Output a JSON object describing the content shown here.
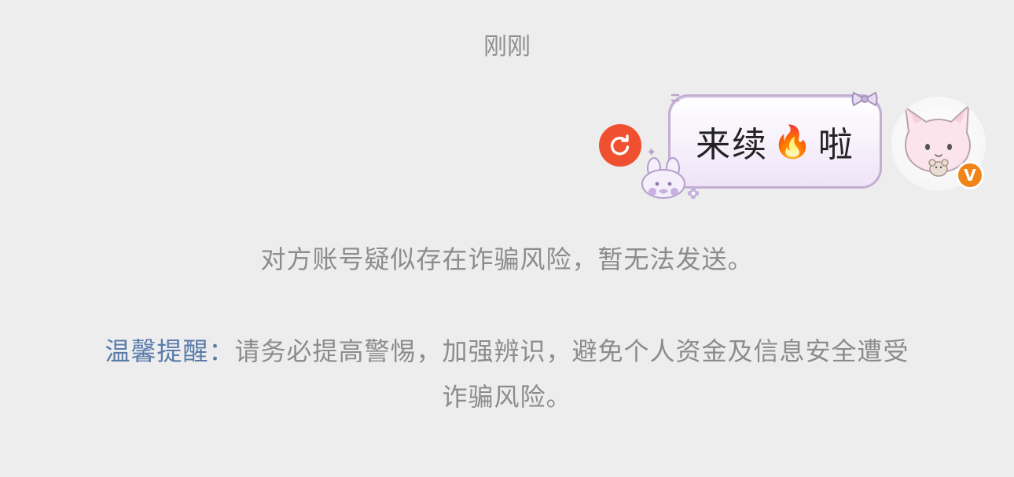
{
  "timestamp": "刚刚",
  "message": {
    "text_before": "来续",
    "emoji": "🔥",
    "text_after": "啦",
    "status_icon": "retry-icon",
    "status_color": "#f0502f",
    "bubble_border_color": "#c2aed2"
  },
  "avatar": {
    "icon": "cat-avatar-icon",
    "badge_text": "V",
    "badge_color": "#f08419"
  },
  "notice": {
    "risk_message": "对方账号疑似存在诈骗风险，暂无法发送。",
    "tip_label": "温馨提醒：",
    "tip_text": "请务必提高警惕，加强辨识，避免个人资金及信息安全遭受诈骗风险。",
    "tip_label_color": "#5a7bab"
  }
}
